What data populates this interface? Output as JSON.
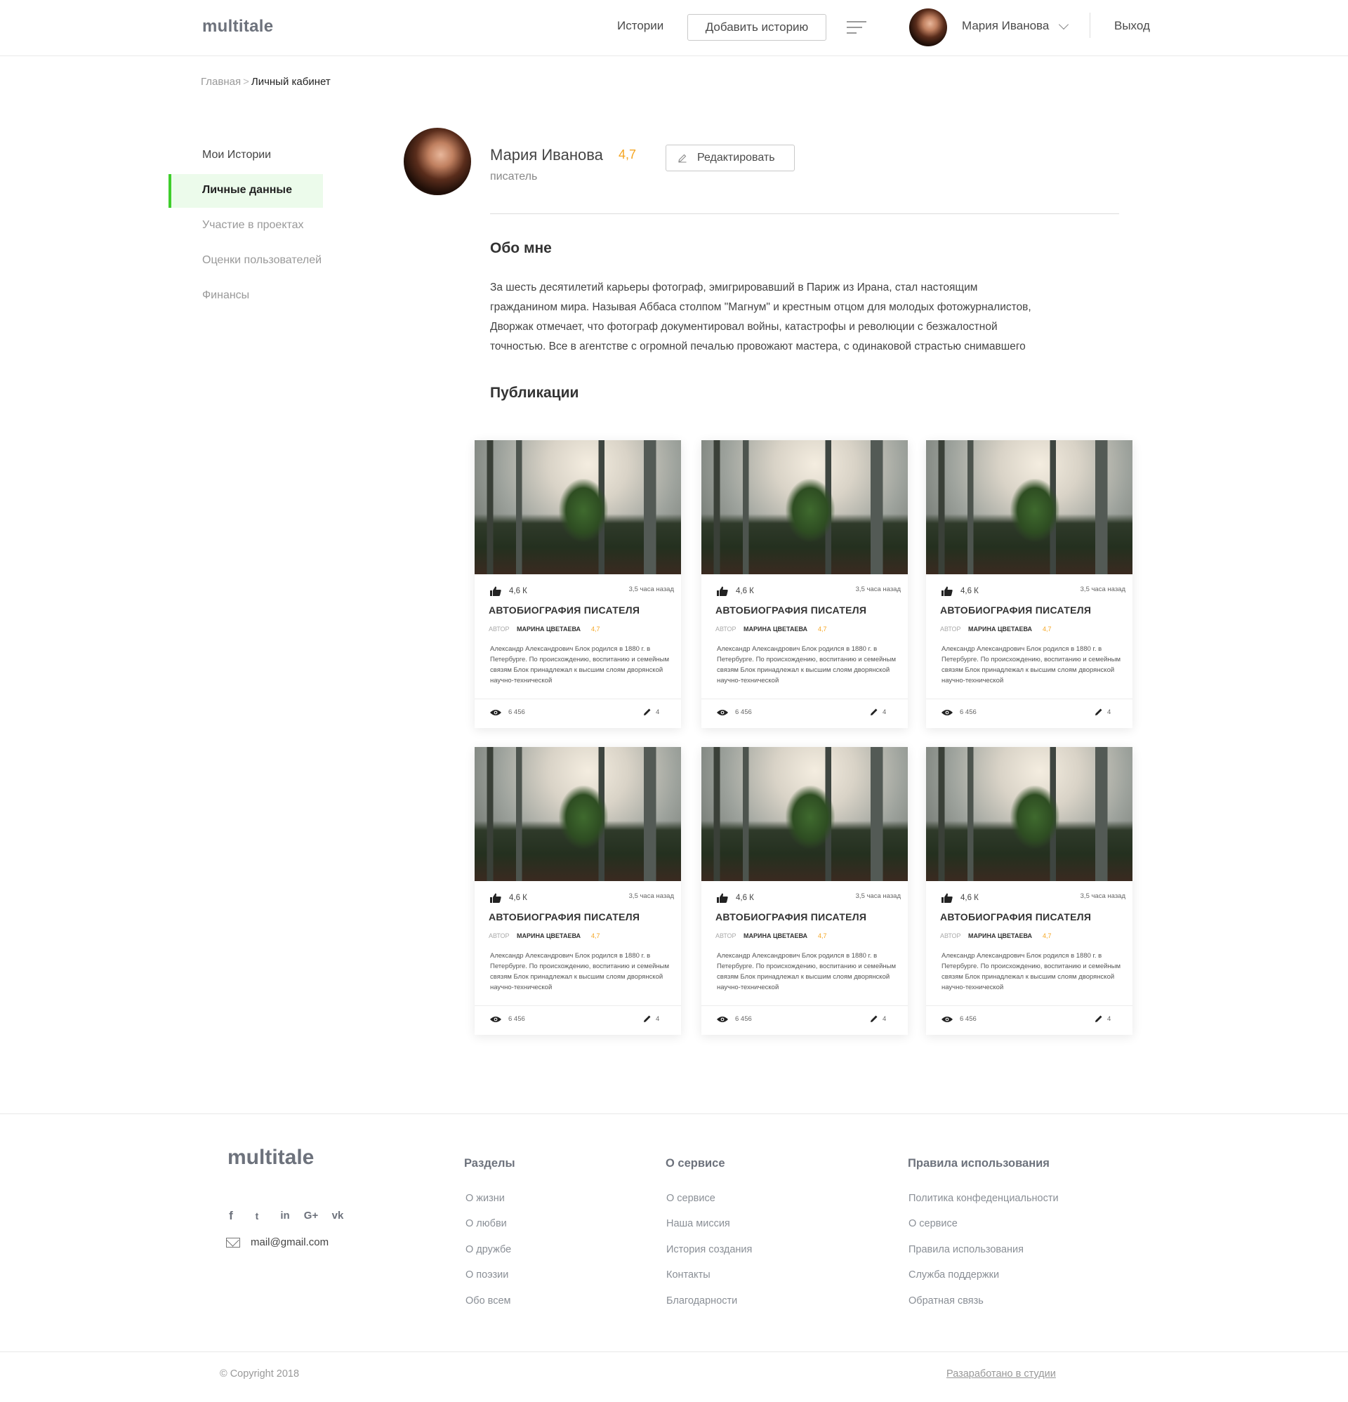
{
  "header": {
    "logo": "multitale",
    "nav_stories": "Истории",
    "add_story": "Добавить историю",
    "user_name": "Мария Иванова",
    "logout": "Выход"
  },
  "breadcrumb": {
    "home": "Главная",
    "separator": ">",
    "current": "Личный кабинет"
  },
  "sidebar": {
    "items": [
      {
        "label": "Мои Истории"
      },
      {
        "label": "Личные данные",
        "active": true
      },
      {
        "label": "Участие в проектах"
      },
      {
        "label": "Оценки пользователей"
      },
      {
        "label": "Финансы"
      }
    ]
  },
  "profile": {
    "name": "Мария Иванова",
    "rating": "4,7",
    "role": "писатель",
    "edit_label": "Редактировать"
  },
  "about": {
    "title": "Обо мне",
    "lines": [
      "За шесть десятилетий карьеры фотограф, эмигрировавший в Париж из Ирана, стал настоящим",
      "гражданином мира. Называя Аббаса столпом \"Магнум\" и крестным отцом для молодых фотожурналистов,",
      "Дворжак отмечает, что фотограф документировал войны, катастрофы и революции с безжалостной",
      "точностью. Все в агентстве с огромной печалью провожают мастера, с одинаковой страстью снимавшего"
    ]
  },
  "publications": {
    "title": "Публикации",
    "cards": [
      {
        "likes": "4,6 К",
        "time": "3,5 часа назад",
        "title": "АВТОБИОГРАФИЯ ПИСАТЕЛЯ",
        "author_label": "АВТОР",
        "author": "МАРИНА ЦВЕТАЕВА",
        "author_rating": "4,7",
        "text": "Александр Александрович Блок родился в 1880 г. в Петербурге. По происхождению, воспитанию и семейным связям Блок принадлежал к высшим слоям дворянской научно-технической",
        "views": "6 456",
        "edits": "4"
      },
      {
        "likes": "4,6 К",
        "time": "3,5 часа назад",
        "title": "АВТОБИОГРАФИЯ ПИСАТЕЛЯ",
        "author_label": "АВТОР",
        "author": "МАРИНА ЦВЕТАЕВА",
        "author_rating": "4,7",
        "text": "Александр Александрович Блок родился в 1880 г. в Петербурге. По происхождению, воспитанию и семейным связям Блок принадлежал к высшим слоям дворянской научно-технической",
        "views": "6 456",
        "edits": "4"
      },
      {
        "likes": "4,6 К",
        "time": "3,5 часа назад",
        "title": "АВТОБИОГРАФИЯ ПИСАТЕЛЯ",
        "author_label": "АВТОР",
        "author": "МАРИНА ЦВЕТАЕВА",
        "author_rating": "4,7",
        "text": "Александр Александрович Блок родился в 1880 г. в Петербурге. По происхождению, воспитанию и семейным связям Блок принадлежал к высшим слоям дворянской научно-технической",
        "views": "6 456",
        "edits": "4"
      },
      {
        "likes": "4,6 К",
        "time": "3,5 часа назад",
        "title": "АВТОБИОГРАФИЯ ПИСАТЕЛЯ",
        "author_label": "АВТОР",
        "author": "МАРИНА ЦВЕТАЕВА",
        "author_rating": "4,7",
        "text": "Александр Александрович Блок родился в 1880 г. в Петербурге. По происхождению, воспитанию и семейным связям Блок принадлежал к высшим слоям дворянской научно-технической",
        "views": "6 456",
        "edits": "4"
      },
      {
        "likes": "4,6 К",
        "time": "3,5 часа назад",
        "title": "АВТОБИОГРАФИЯ ПИСАТЕЛЯ",
        "author_label": "АВТОР",
        "author": "МАРИНА ЦВЕТАЕВА",
        "author_rating": "4,7",
        "text": "Александр Александрович Блок родился в 1880 г. в Петербурге. По происхождению, воспитанию и семейным связям Блок принадлежал к высшим слоям дворянской научно-технической",
        "views": "6 456",
        "edits": "4"
      },
      {
        "likes": "4,6 К",
        "time": "3,5 часа назад",
        "title": "АВТОБИОГРАФИЯ ПИСАТЕЛЯ",
        "author_label": "АВТОР",
        "author": "МАРИНА ЦВЕТАЕВА",
        "author_rating": "4,7",
        "text": "Александр Александрович Блок родился в 1880 г. в Петербурге. По происхождению, воспитанию и семейным связям Блок принадлежал к высшим слоям дворянской научно-технической",
        "views": "6 456",
        "edits": "4"
      }
    ]
  },
  "footer": {
    "logo": "multitale",
    "social": [
      {
        "icon": "facebook-icon",
        "glyph": "f"
      },
      {
        "icon": "twitter-icon",
        "glyph": "t"
      },
      {
        "icon": "linkedin-icon",
        "glyph": "in"
      },
      {
        "icon": "google-plus-icon",
        "glyph": "G+"
      },
      {
        "icon": "vk-icon",
        "glyph": "vk"
      }
    ],
    "email": "mail@gmail.com",
    "columns": [
      {
        "title": "Разделы",
        "links": [
          "О жизни",
          "О любви",
          "О дружбе",
          "О поэзии",
          "Обо всем"
        ]
      },
      {
        "title": "О сервисе",
        "links": [
          "О сервисе",
          "Наша миссия",
          "История создания",
          "Контакты",
          "Благодарности"
        ]
      },
      {
        "title": "Правила использования",
        "links": [
          "Политика конфеденциальности",
          "О сервисе",
          "Правила использования",
          "Служба поддержки",
          "Обратная связь"
        ]
      }
    ],
    "copyright": "© Copyright 2018",
    "studio": "Разаработано в студии"
  },
  "colors": {
    "accent_green": "#3fce2c",
    "active_bg": "#ecfbeb",
    "rating_orange": "#f5a623"
  }
}
